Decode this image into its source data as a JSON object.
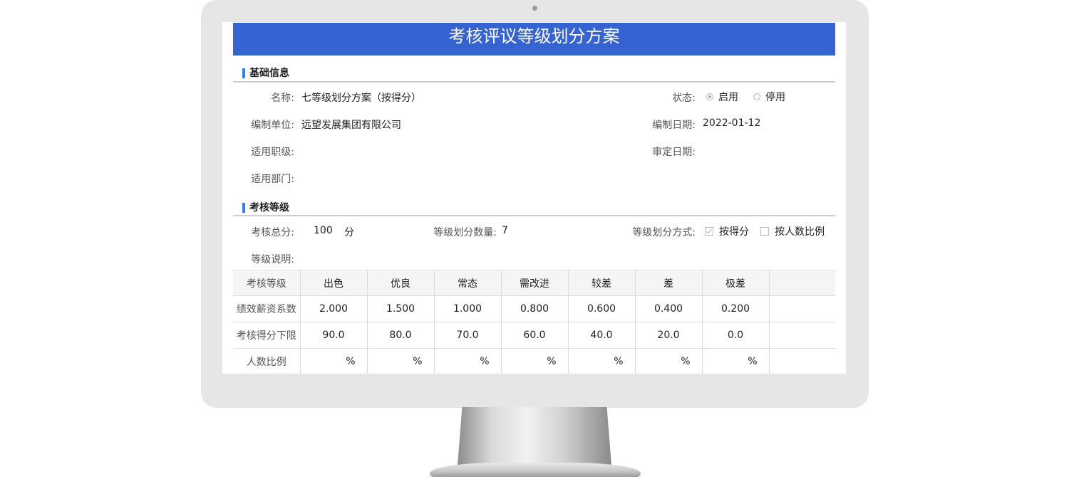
{
  "page_title": "考核评议等级划分方案",
  "basic_info": {
    "section_title": "基础信息",
    "name_label": "名称:",
    "name_value": "七等级划分方案（按得分）",
    "status_label": "状态:",
    "status_options": [
      "启用",
      "停用"
    ],
    "status_selected": "启用",
    "org_label": "编制单位:",
    "org_value": "远望发展集团有限公司",
    "date_label": "编制日期:",
    "date_value": "2022-01-12",
    "rank_label": "适用职级:",
    "approve_date_label": "审定日期:",
    "dept_label": "适用部门:"
  },
  "grades": {
    "section_title": "考核等级",
    "total_label": "考核总分:",
    "total_value": "100",
    "total_unit": "分",
    "count_label": "等级划分数量:",
    "count_value": "7",
    "method_label": "等级划分方式:",
    "method_options": [
      "按得分",
      "按人数比例"
    ],
    "method_checked": [
      true,
      false
    ],
    "desc_label": "等级说明:",
    "table": {
      "row_headers": [
        "考核等级",
        "绩效薪资系数",
        "考核得分下限",
        "人数比例"
      ],
      "levels": [
        "出色",
        "优良",
        "常态",
        "需改进",
        "较差",
        "差",
        "极差"
      ],
      "coefficients": [
        "2.000",
        "1.500",
        "1.000",
        "0.800",
        "0.600",
        "0.400",
        "0.200"
      ],
      "min_scores": [
        "90.0",
        "80.0",
        "70.0",
        "60.0",
        "40.0",
        "20.0",
        "0.0"
      ],
      "ratio_unit": "%"
    }
  },
  "colors": {
    "header_bg": "#3563d1",
    "section_marker": "#2f80ff",
    "bezel": "#e6e6e6"
  }
}
